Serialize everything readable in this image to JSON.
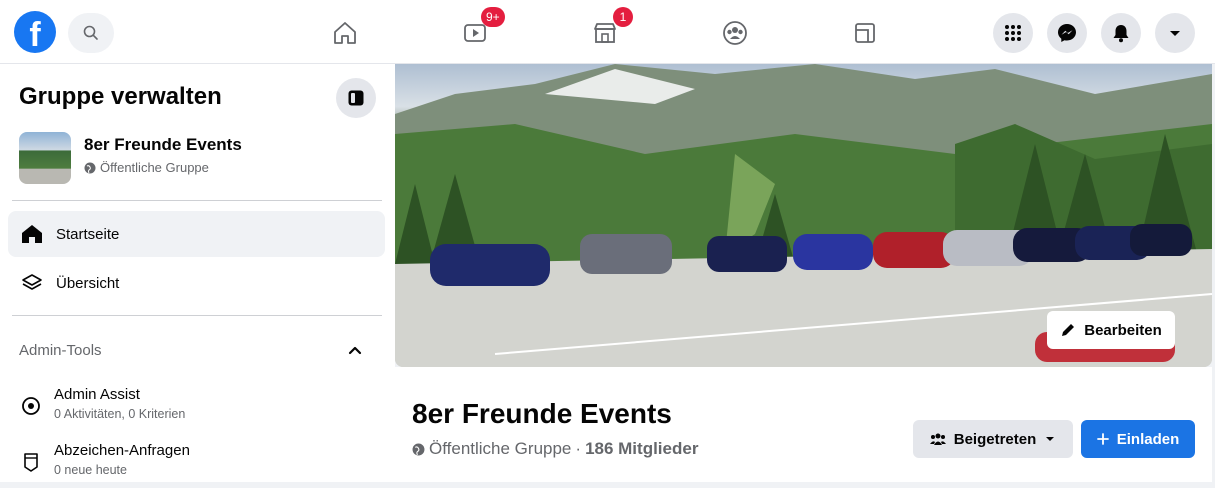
{
  "topbar": {
    "logo_letter": "f",
    "nav": [
      {
        "name": "home",
        "badge": ""
      },
      {
        "name": "watch",
        "badge": "9+"
      },
      {
        "name": "marketplace",
        "badge": "1"
      },
      {
        "name": "groups",
        "badge": ""
      },
      {
        "name": "gaming",
        "badge": ""
      }
    ]
  },
  "sidebar": {
    "title": "Gruppe verwalten",
    "group": {
      "name": "8er Freunde Events",
      "type": "Öffentliche Gruppe"
    },
    "nav": [
      {
        "label": "Startseite",
        "active": true,
        "icon": "home-icon"
      },
      {
        "label": "Übersicht",
        "active": false,
        "icon": "overview-icon"
      }
    ],
    "admin_tools": {
      "header": "Admin-Tools",
      "items": [
        {
          "title": "Admin Assist",
          "subtitle": "0 Aktivitäten, 0 Kriterien",
          "icon": "admin-assist-icon"
        },
        {
          "title": "Abzeichen-Anfragen",
          "subtitle": "0 neue heute",
          "icon": "badge-icon"
        }
      ]
    }
  },
  "cover": {
    "edit_label": "Bearbeiten"
  },
  "group_header": {
    "name": "8er Freunde Events",
    "type": "Öffentliche Gruppe",
    "separator": "·",
    "members": "186 Mitglieder",
    "joined_label": "Beigetreten",
    "invite_label": "Einladen"
  },
  "colors": {
    "brand": "#1877f2",
    "badge": "#e41e3f",
    "invite": "#1b74e4"
  }
}
